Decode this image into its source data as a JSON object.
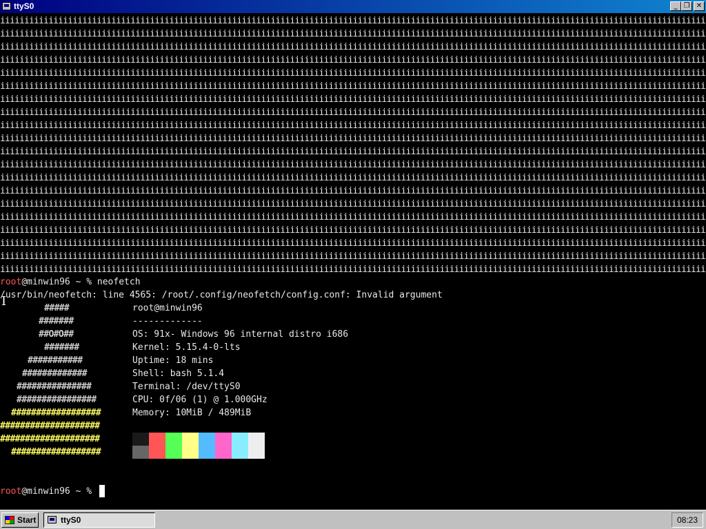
{
  "window": {
    "title": "ttyS0",
    "minimize_label": "_",
    "maximize_label": "❐",
    "close_label": "✕"
  },
  "terminal": {
    "fill_line": "iiiiiiiiiiiiiiiiiiiiiiiiiiiiiiiiiiiiiiiiiiiiiiiiiiiiiiiiiiiiiiiiiiiiiiiiiiiiiiiiiiiiiiiiiiiiiiiiiiiiiiiiiiiiiiiiiiiiiiiiiiiiiiiiiiiiiiiiiiiiiiiiiiiiiiiiiiiiiii",
    "prompt_user": "root",
    "prompt_host": "@minwin96",
    "prompt_rest": " ~ % ",
    "command": "neofetch",
    "error_line": "/usr/bin/neofetch: line 4565: /root/.config/neofetch/config.conf: Invalid argument",
    "info": {
      "header": "root@minwin96",
      "separator": "-------------",
      "os": "OS: 91x- Windows 96 internal distro i686",
      "kernel": "Kernel: 5.15.4-0-lts",
      "uptime": "Uptime: 18 mins",
      "shell": "Shell: bash 5.1.4",
      "terminal": "Terminal: /dev/ttyS0",
      "cpu": "CPU: 0f/06 (1) @ 1.000GHz",
      "memory": "Memory: 10MiB / 489MiB"
    },
    "logo_lines": [
      "#####",
      "#######",
      "##O#O##",
      "#######",
      "###########",
      "#############",
      "###############",
      "################",
      "##################",
      "####################",
      "####################",
      "##################"
    ],
    "palette_top": [
      "#1a1a1a",
      "#ff5555",
      "#55ff55",
      "#ffff88",
      "#55bbff",
      "#ff66cc",
      "#88eeff",
      "#eeeeee"
    ],
    "palette_bottom": [
      "#666666",
      "#ff5555",
      "#55ff55",
      "#ffff88",
      "#55bbff",
      "#ff66cc",
      "#88eeff",
      "#eeeeee"
    ],
    "logo_white": "#cfcfcf",
    "logo_yellow": "#ffff66"
  },
  "taskbar": {
    "start_label": "Start",
    "task_label": "ttyS0",
    "clock": "08:23"
  }
}
